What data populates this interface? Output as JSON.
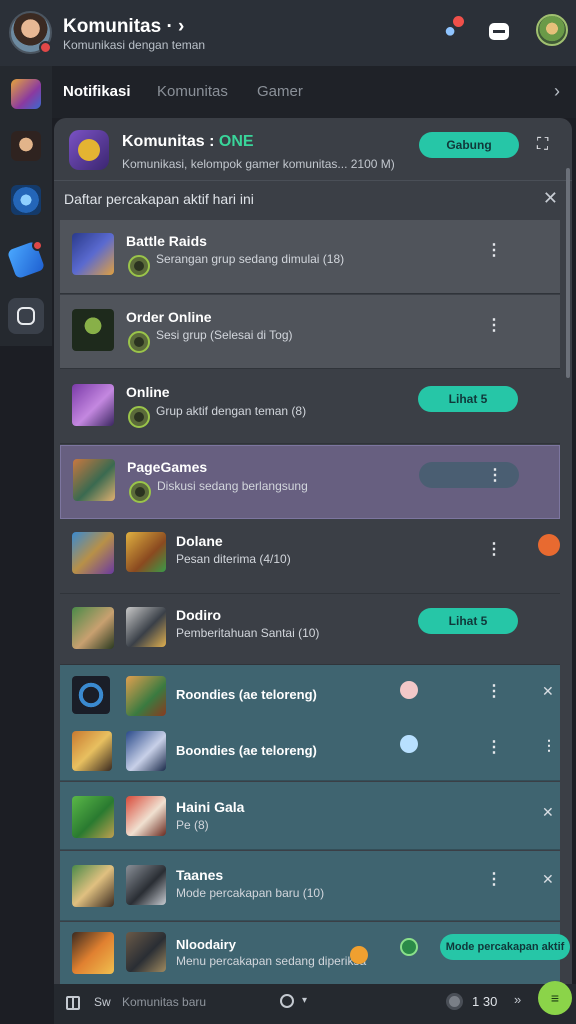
{
  "header": {
    "app_title": "Komunitas · ›",
    "app_subtitle": "Komunikasi dengan teman",
    "bell_icon": "bell-icon",
    "chat_icon": "chat-bubble-icon"
  },
  "tabs": [
    {
      "label": "Notifikasi",
      "active": true
    },
    {
      "label": "Komunitas",
      "active": false
    },
    {
      "label": "Gamer",
      "active": false
    }
  ],
  "tabs_arrow": "›",
  "panel": {
    "title": "Komunitas :",
    "title_status": "ONE",
    "subtitle": "Komunikasi, kelompok gamer komunitas... 2100 M)",
    "action_label": "Gabung",
    "expand_icon": "⛶",
    "section_title": "Daftar percakapan aktif hari ini",
    "section_close": "✕"
  },
  "rows": [
    {
      "title": "Battle Raids",
      "subtitle": "Serangan grup sedang dimulai (18)",
      "more": "⋮"
    },
    {
      "title": "Order Online",
      "subtitle": "Sesi grup (Selesai di Tog)",
      "more": "⋮"
    },
    {
      "title": "Online",
      "subtitle": "Grup aktif dengan teman (8)",
      "pill": "Lihat 5"
    },
    {
      "title": "PageGames",
      "subtitle": "Diskusi sedang berlangsung",
      "more": "⋮"
    },
    {
      "title": "Dolane",
      "subtitle": "Pesan diterima (4/10)",
      "more": "⋮"
    },
    {
      "title": "Dodiro",
      "subtitle": "Pemberitahuan Santai (10)",
      "pill": "Lihat 5"
    },
    {
      "title": "Roondies (ae teloreng)",
      "subtitle": "",
      "more": "⋮",
      "close": "✕"
    },
    {
      "title": "Boondies (ae teloreng)",
      "subtitle": "",
      "more": "⋮",
      "close": "⋮"
    },
    {
      "title": "Haini Gala",
      "subtitle": "Pe (8)",
      "close": "✕"
    },
    {
      "title": "Taanes",
      "subtitle": "Mode percakapan baru (10)",
      "more": "⋮",
      "close": "✕"
    },
    {
      "title": "Nloodairy",
      "subtitle": "Menu percakapan sedang diperiksa",
      "pill": "Mode percakapan aktif"
    }
  ],
  "bottombar": {
    "left_label": "Sw",
    "left_hint": "Komunitas baru",
    "count": "1 30",
    "send": "»"
  },
  "fab_icon": "≡"
}
